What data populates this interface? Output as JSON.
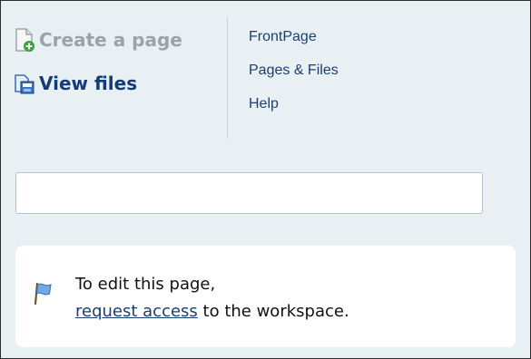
{
  "actions": {
    "create_page_label": "Create a page",
    "view_files_label": "View files"
  },
  "nav": {
    "items": [
      {
        "label": "FrontPage"
      },
      {
        "label": "Pages & Files"
      },
      {
        "label": "Help"
      }
    ]
  },
  "search": {
    "value": "",
    "placeholder": ""
  },
  "notice": {
    "line1": "To edit this page,",
    "link_label": "request access",
    "suffix": " to the workspace."
  },
  "colors": {
    "background": "#e9f0f4",
    "link": "#1b3f6e",
    "disabled_text": "#9aa3aa"
  },
  "icons": {
    "create_page": "new-page-icon",
    "view_files": "files-icon",
    "notice": "flag-icon"
  }
}
